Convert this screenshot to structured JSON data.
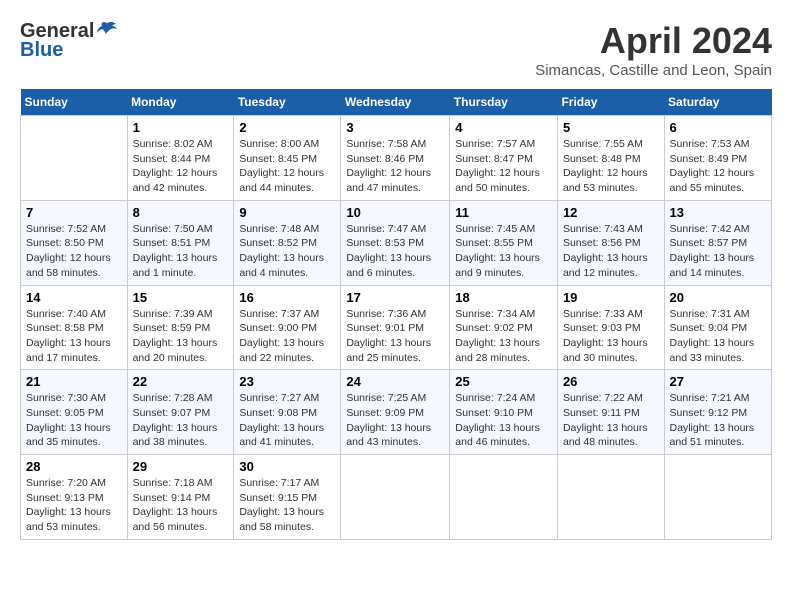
{
  "header": {
    "logo_general": "General",
    "logo_blue": "Blue",
    "month_title": "April 2024",
    "location": "Simancas, Castille and Leon, Spain"
  },
  "weekdays": [
    "Sunday",
    "Monday",
    "Tuesday",
    "Wednesday",
    "Thursday",
    "Friday",
    "Saturday"
  ],
  "weeks": [
    [
      {
        "day": "",
        "sunrise": "",
        "sunset": "",
        "daylight": ""
      },
      {
        "day": "1",
        "sunrise": "Sunrise: 8:02 AM",
        "sunset": "Sunset: 8:44 PM",
        "daylight": "Daylight: 12 hours and 42 minutes."
      },
      {
        "day": "2",
        "sunrise": "Sunrise: 8:00 AM",
        "sunset": "Sunset: 8:45 PM",
        "daylight": "Daylight: 12 hours and 44 minutes."
      },
      {
        "day": "3",
        "sunrise": "Sunrise: 7:58 AM",
        "sunset": "Sunset: 8:46 PM",
        "daylight": "Daylight: 12 hours and 47 minutes."
      },
      {
        "day": "4",
        "sunrise": "Sunrise: 7:57 AM",
        "sunset": "Sunset: 8:47 PM",
        "daylight": "Daylight: 12 hours and 50 minutes."
      },
      {
        "day": "5",
        "sunrise": "Sunrise: 7:55 AM",
        "sunset": "Sunset: 8:48 PM",
        "daylight": "Daylight: 12 hours and 53 minutes."
      },
      {
        "day": "6",
        "sunrise": "Sunrise: 7:53 AM",
        "sunset": "Sunset: 8:49 PM",
        "daylight": "Daylight: 12 hours and 55 minutes."
      }
    ],
    [
      {
        "day": "7",
        "sunrise": "Sunrise: 7:52 AM",
        "sunset": "Sunset: 8:50 PM",
        "daylight": "Daylight: 12 hours and 58 minutes."
      },
      {
        "day": "8",
        "sunrise": "Sunrise: 7:50 AM",
        "sunset": "Sunset: 8:51 PM",
        "daylight": "Daylight: 13 hours and 1 minute."
      },
      {
        "day": "9",
        "sunrise": "Sunrise: 7:48 AM",
        "sunset": "Sunset: 8:52 PM",
        "daylight": "Daylight: 13 hours and 4 minutes."
      },
      {
        "day": "10",
        "sunrise": "Sunrise: 7:47 AM",
        "sunset": "Sunset: 8:53 PM",
        "daylight": "Daylight: 13 hours and 6 minutes."
      },
      {
        "day": "11",
        "sunrise": "Sunrise: 7:45 AM",
        "sunset": "Sunset: 8:55 PM",
        "daylight": "Daylight: 13 hours and 9 minutes."
      },
      {
        "day": "12",
        "sunrise": "Sunrise: 7:43 AM",
        "sunset": "Sunset: 8:56 PM",
        "daylight": "Daylight: 13 hours and 12 minutes."
      },
      {
        "day": "13",
        "sunrise": "Sunrise: 7:42 AM",
        "sunset": "Sunset: 8:57 PM",
        "daylight": "Daylight: 13 hours and 14 minutes."
      }
    ],
    [
      {
        "day": "14",
        "sunrise": "Sunrise: 7:40 AM",
        "sunset": "Sunset: 8:58 PM",
        "daylight": "Daylight: 13 hours and 17 minutes."
      },
      {
        "day": "15",
        "sunrise": "Sunrise: 7:39 AM",
        "sunset": "Sunset: 8:59 PM",
        "daylight": "Daylight: 13 hours and 20 minutes."
      },
      {
        "day": "16",
        "sunrise": "Sunrise: 7:37 AM",
        "sunset": "Sunset: 9:00 PM",
        "daylight": "Daylight: 13 hours and 22 minutes."
      },
      {
        "day": "17",
        "sunrise": "Sunrise: 7:36 AM",
        "sunset": "Sunset: 9:01 PM",
        "daylight": "Daylight: 13 hours and 25 minutes."
      },
      {
        "day": "18",
        "sunrise": "Sunrise: 7:34 AM",
        "sunset": "Sunset: 9:02 PM",
        "daylight": "Daylight: 13 hours and 28 minutes."
      },
      {
        "day": "19",
        "sunrise": "Sunrise: 7:33 AM",
        "sunset": "Sunset: 9:03 PM",
        "daylight": "Daylight: 13 hours and 30 minutes."
      },
      {
        "day": "20",
        "sunrise": "Sunrise: 7:31 AM",
        "sunset": "Sunset: 9:04 PM",
        "daylight": "Daylight: 13 hours and 33 minutes."
      }
    ],
    [
      {
        "day": "21",
        "sunrise": "Sunrise: 7:30 AM",
        "sunset": "Sunset: 9:05 PM",
        "daylight": "Daylight: 13 hours and 35 minutes."
      },
      {
        "day": "22",
        "sunrise": "Sunrise: 7:28 AM",
        "sunset": "Sunset: 9:07 PM",
        "daylight": "Daylight: 13 hours and 38 minutes."
      },
      {
        "day": "23",
        "sunrise": "Sunrise: 7:27 AM",
        "sunset": "Sunset: 9:08 PM",
        "daylight": "Daylight: 13 hours and 41 minutes."
      },
      {
        "day": "24",
        "sunrise": "Sunrise: 7:25 AM",
        "sunset": "Sunset: 9:09 PM",
        "daylight": "Daylight: 13 hours and 43 minutes."
      },
      {
        "day": "25",
        "sunrise": "Sunrise: 7:24 AM",
        "sunset": "Sunset: 9:10 PM",
        "daylight": "Daylight: 13 hours and 46 minutes."
      },
      {
        "day": "26",
        "sunrise": "Sunrise: 7:22 AM",
        "sunset": "Sunset: 9:11 PM",
        "daylight": "Daylight: 13 hours and 48 minutes."
      },
      {
        "day": "27",
        "sunrise": "Sunrise: 7:21 AM",
        "sunset": "Sunset: 9:12 PM",
        "daylight": "Daylight: 13 hours and 51 minutes."
      }
    ],
    [
      {
        "day": "28",
        "sunrise": "Sunrise: 7:20 AM",
        "sunset": "Sunset: 9:13 PM",
        "daylight": "Daylight: 13 hours and 53 minutes."
      },
      {
        "day": "29",
        "sunrise": "Sunrise: 7:18 AM",
        "sunset": "Sunset: 9:14 PM",
        "daylight": "Daylight: 13 hours and 56 minutes."
      },
      {
        "day": "30",
        "sunrise": "Sunrise: 7:17 AM",
        "sunset": "Sunset: 9:15 PM",
        "daylight": "Daylight: 13 hours and 58 minutes."
      },
      {
        "day": "",
        "sunrise": "",
        "sunset": "",
        "daylight": ""
      },
      {
        "day": "",
        "sunrise": "",
        "sunset": "",
        "daylight": ""
      },
      {
        "day": "",
        "sunrise": "",
        "sunset": "",
        "daylight": ""
      },
      {
        "day": "",
        "sunrise": "",
        "sunset": "",
        "daylight": ""
      }
    ]
  ]
}
